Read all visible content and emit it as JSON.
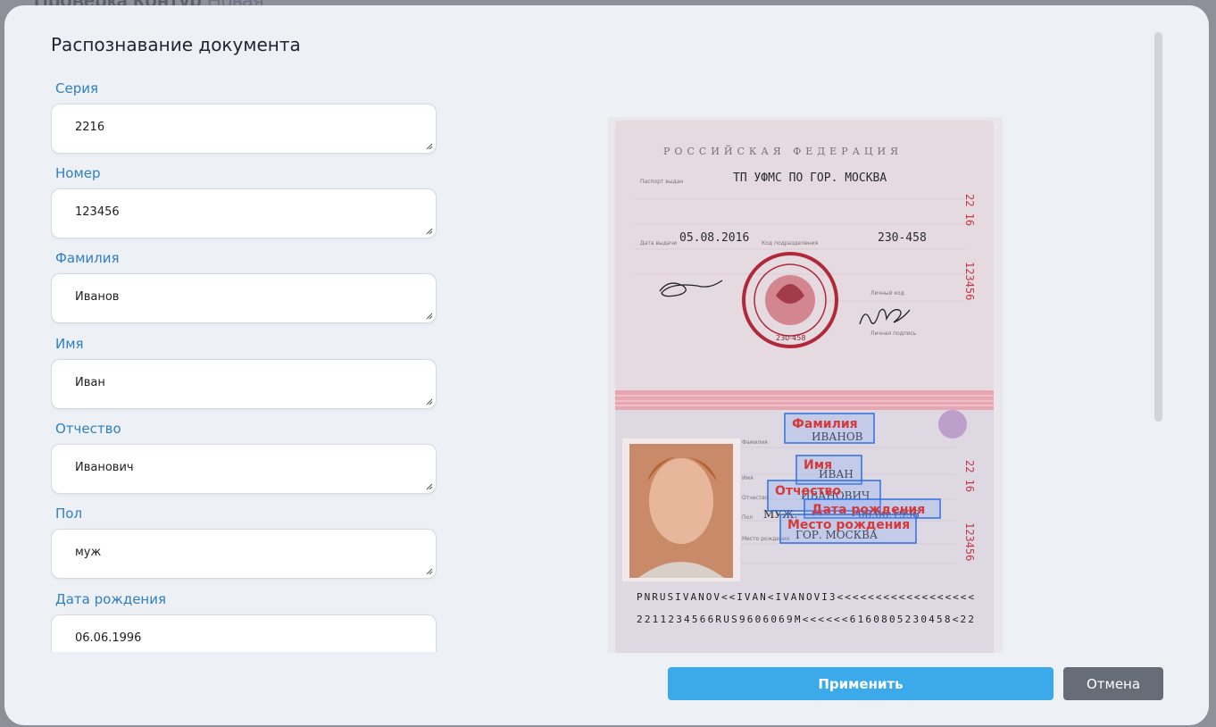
{
  "background": {
    "title": "Проверка Контур",
    "badge": "Новая"
  },
  "modal": {
    "title": "Распознавание документа"
  },
  "fields": [
    {
      "label": "Серия",
      "value": "2216"
    },
    {
      "label": "Номер",
      "value": "123456"
    },
    {
      "label": "Фамилия",
      "value": "Иванов"
    },
    {
      "label": "Имя",
      "value": "Иван"
    },
    {
      "label": "Отчество",
      "value": "Иванович"
    },
    {
      "label": "Пол",
      "value": "муж"
    },
    {
      "label": "Дата рождения",
      "value": "06.06.1996"
    }
  ],
  "passport": {
    "country": "РОССИЙСКАЯ ФЕДЕРАЦИЯ",
    "issued_by_caption": "Паспорт выдан",
    "issued_by": "ТП УФМС ПО ГОР. МОСКВА",
    "issue_date_caption": "Дата выдачи",
    "issue_date": "05.08.2016",
    "division_caption": "Код подразделения",
    "division_code": "230-458",
    "personal_sign_caption": "Личный код",
    "signature_caption": "Личная подпись",
    "stamp_number": "230-458",
    "series_side": "22 16",
    "number_side": "123456",
    "surname_caption": "Фамилия",
    "surname": "ИВАНОВ",
    "name_caption": "Имя",
    "name": "ИВАН",
    "patronymic_caption": "Отчество",
    "patronymic": "ИВАНОВИЧ",
    "sex_caption": "Пол",
    "sex": "МУЖ.",
    "birth_date": "06.06.1996",
    "birth_place_caption": "Место рождения",
    "birth_place": "ГОР. МОСКВА",
    "mrz_line1": "PNRUSIVANOV<<IVAN<IVANOVI3<<<<<<<<<<<<<<<<<<",
    "mrz_line2": "2211234566RUS9606069M<<<<<<6160805230458<22"
  },
  "overlays": {
    "surname": "Фамилия",
    "name": "Имя",
    "patronymic": "Отчество",
    "birth_date": "Дата рождения",
    "birth_place": "Место рождения"
  },
  "actions": {
    "apply": "Применить",
    "cancel": "Отмена"
  },
  "colors": {
    "accent": "#3ba9ea",
    "label": "#2f7fc1",
    "overlay_text": "#d43a3a",
    "overlay_box": "#2f6fe0"
  }
}
